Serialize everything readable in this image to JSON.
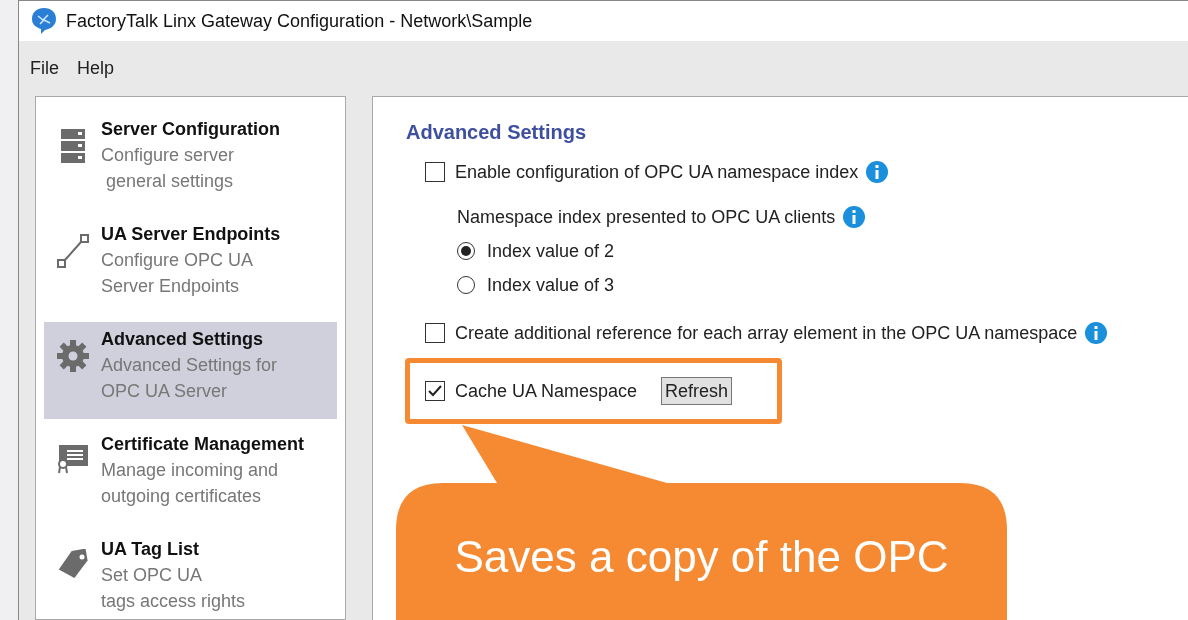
{
  "window": {
    "title": "FactoryTalk Linx Gateway Configuration - Network\\Sample"
  },
  "menu": [
    {
      "label": "File"
    },
    {
      "label": "Help"
    }
  ],
  "sidebar": {
    "items": [
      {
        "title": "Server Configuration",
        "description": [
          "Configure server",
          " general settings"
        ],
        "selected": false
      },
      {
        "title": "UA Server Endpoints",
        "description": [
          "Configure OPC UA",
          "Server Endpoints"
        ],
        "selected": false
      },
      {
        "title": "Advanced Settings",
        "description": [
          "Advanced Settings for",
          "OPC UA Server"
        ],
        "selected": true
      },
      {
        "title": "Certificate Management",
        "description": [
          "Manage incoming and",
          "outgoing certificates"
        ],
        "selected": false
      },
      {
        "title": "UA Tag List",
        "description": [
          "Set OPC UA",
          "tags access rights"
        ],
        "selected": false
      }
    ]
  },
  "content": {
    "heading": "Advanced Settings",
    "items": [
      {
        "kind": "checkbox",
        "label": "Enable configuration of OPC UA namespace index",
        "checked": false,
        "info": true
      },
      {
        "kind": "label",
        "label": "Namespace index presented to OPC UA clients",
        "info": true
      },
      {
        "kind": "radio",
        "label": "Index value of 2",
        "selected": true
      },
      {
        "kind": "radio",
        "label": "Index value of 3",
        "selected": false
      },
      {
        "kind": "checkbox",
        "label": "Create additional reference for each array element in the OPC UA namespace",
        "checked": false,
        "info": true
      },
      {
        "kind": "checkbox",
        "label": "Cache UA Namespace",
        "checked": true,
        "button": "Refresh",
        "highlighted": true
      }
    ]
  },
  "callout": {
    "text": "Saves a copy of the OPC"
  }
}
